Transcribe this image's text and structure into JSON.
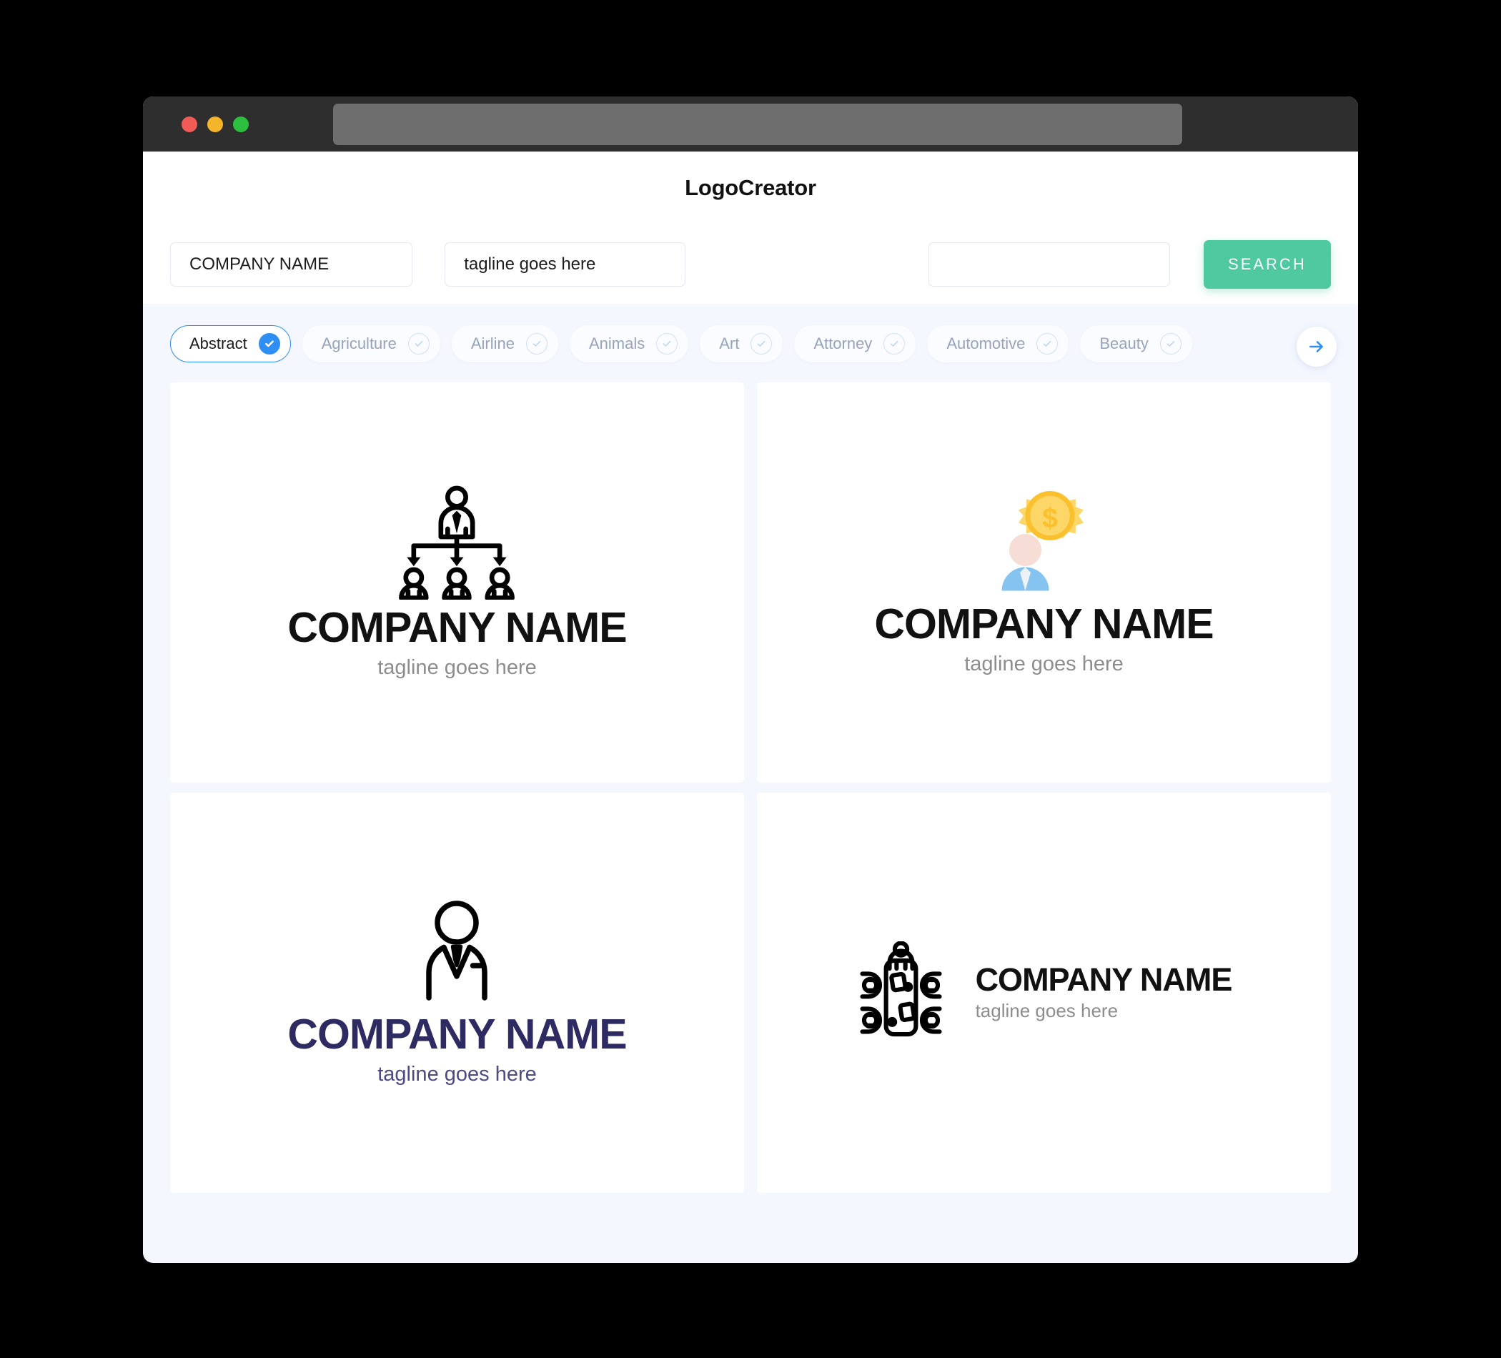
{
  "window": {
    "traffic_lights": [
      "close",
      "minimize",
      "maximize"
    ],
    "url_value": ""
  },
  "header": {
    "app_title": "LogoCreator"
  },
  "search": {
    "company_value": "COMPANY NAME",
    "tagline_value": "tagline goes here",
    "keyword_value": "",
    "keyword_placeholder": "",
    "search_label": "SEARCH"
  },
  "categories": {
    "items": [
      {
        "label": "Abstract",
        "selected": true
      },
      {
        "label": "Agriculture",
        "selected": false
      },
      {
        "label": "Airline",
        "selected": false
      },
      {
        "label": "Animals",
        "selected": false
      },
      {
        "label": "Art",
        "selected": false
      },
      {
        "label": "Attorney",
        "selected": false
      },
      {
        "label": "Automotive",
        "selected": false
      },
      {
        "label": "Beauty",
        "selected": false
      }
    ],
    "next_label": "next"
  },
  "logos": [
    {
      "icon": "org-chart-hierarchy-icon",
      "name": "COMPANY NAME",
      "tagline": "tagline goes here",
      "name_color": "#111111",
      "tagline_color": "#8d8d8d",
      "layout": "stacked"
    },
    {
      "icon": "businessman-gear-coin-icon",
      "name": "COMPANY NAME",
      "tagline": "tagline goes here",
      "name_color": "#111111",
      "tagline_color": "#8d8d8d",
      "layout": "stacked"
    },
    {
      "icon": "businessman-outline-icon",
      "name": "COMPANY NAME",
      "tagline": "tagline goes here",
      "name_color": "#2e2b63",
      "tagline_color": "#4d4a85",
      "layout": "stacked"
    },
    {
      "icon": "conference-table-meeting-icon",
      "name": "COMPANY NAME",
      "tagline": "tagline goes here",
      "name_color": "#111111",
      "tagline_color": "#9a9a9a",
      "layout": "horizontal"
    }
  ],
  "colors": {
    "accent_green": "#4ec9a0",
    "accent_blue": "#2f8ef4",
    "page_bg": "#f4f7fe",
    "titlebar": "#2e2e2e",
    "navy": "#2e2b63"
  }
}
